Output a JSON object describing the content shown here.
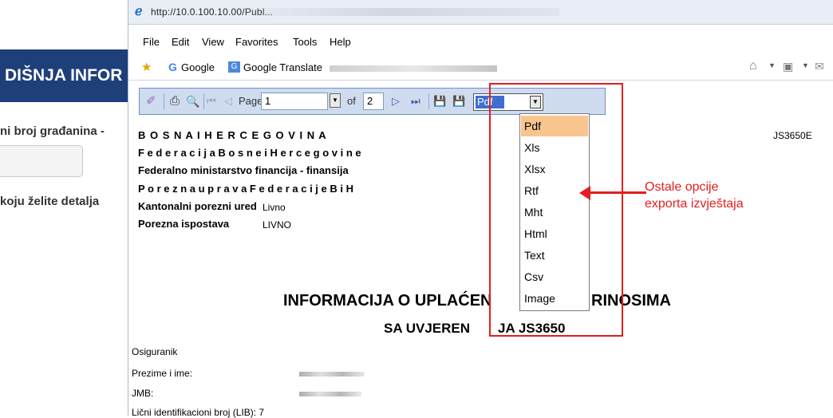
{
  "background_page": {
    "banner_text": "DIŠNJA INFOR",
    "label_1": "ni broj građanina -",
    "label_2": "koju želite detalja"
  },
  "browser": {
    "url": "http://10.0.100.10.00/Publ...",
    "menu": [
      "File",
      "Edit",
      "View",
      "Favorites",
      "Tools",
      "Help"
    ],
    "favorites": {
      "google_label": "Google",
      "google_translate_label": "Google Translate"
    }
  },
  "report_toolbar": {
    "page_label": "Page",
    "page_value": "1",
    "of_label": "of",
    "total_pages": "2",
    "export_format_selected": "Pdf",
    "export_options": [
      "Pdf",
      "Xls",
      "Xlsx",
      "Rtf",
      "Mht",
      "Html",
      "Text",
      "Csv",
      "Image"
    ]
  },
  "annotation": {
    "line1": "Ostale opcije",
    "line2": "exporta izvještaja",
    "color": "#e41e1e"
  },
  "report": {
    "header": [
      "B O S N A   I   H E R C E G O V I N A",
      "F e d e r a c i j a  B o s n e  i  H e r c e g o v i n e",
      "Federalno  ministarstvo  financija  -  finansija",
      "P o r e z n a   u p r a v a   F e d e r a c i j e   B i H"
    ],
    "code": "JS3650E",
    "office_label": "Kantonalni porezni ured",
    "office_value": "Livno",
    "branch_label": "Porezna ispostava",
    "branch_value": "LIVNO",
    "title": "INFORMACIJA O UPLAĆENIM DOPRINOSIMA",
    "title_part_left": "INFORMACIJA O UPLAĆEN",
    "title_part_right": "RINOSIMA",
    "subtitle_left": "SA UVJEREN",
    "subtitle_right": "JA JS3650",
    "fields": {
      "insured_label": "Osiguranik",
      "name_label": "Prezime i ime:",
      "jmb_label": "JMB:",
      "lib_label": "Lični identifikacioni broj (LIB): 7"
    }
  }
}
